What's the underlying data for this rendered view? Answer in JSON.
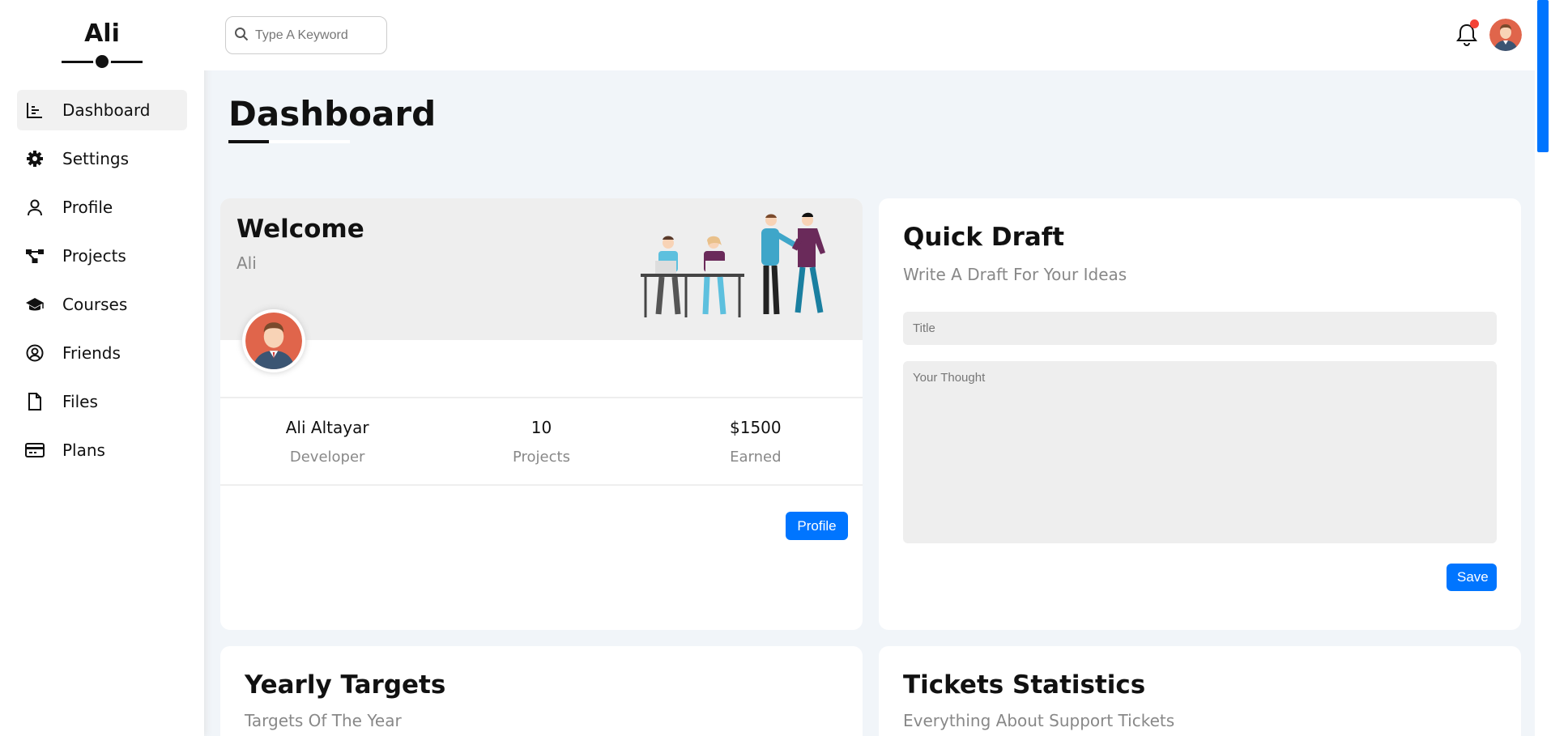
{
  "sidebar": {
    "brand": "Ali",
    "items": [
      {
        "label": "Dashboard",
        "icon": "chart-icon"
      },
      {
        "label": "Settings",
        "icon": "gear-icon"
      },
      {
        "label": "Profile",
        "icon": "user-icon"
      },
      {
        "label": "Projects",
        "icon": "diagram-icon"
      },
      {
        "label": "Courses",
        "icon": "graduation-cap-icon"
      },
      {
        "label": "Friends",
        "icon": "user-circle-icon"
      },
      {
        "label": "Files",
        "icon": "file-icon"
      },
      {
        "label": "Plans",
        "icon": "credit-card-icon"
      }
    ],
    "active": "Dashboard"
  },
  "header": {
    "search_placeholder": "Type A Keyword",
    "notification_icon": "bell-icon"
  },
  "page": {
    "title": "Dashboard"
  },
  "welcome": {
    "title": "Welcome",
    "name": "Ali",
    "stats": [
      {
        "value": "Ali Altayar",
        "label": "Developer"
      },
      {
        "value": "10",
        "label": "Projects"
      },
      {
        "value": "$1500",
        "label": "Earned"
      }
    ],
    "button": "Profile"
  },
  "draft": {
    "title": "Quick Draft",
    "subtitle": "Write A Draft For Your Ideas",
    "title_placeholder": "Title",
    "thought_placeholder": "Your Thought",
    "button": "Save"
  },
  "yearly": {
    "title": "Yearly Targets",
    "subtitle": "Targets Of The Year"
  },
  "tickets": {
    "title": "Tickets Statistics",
    "subtitle": "Everything About Support Tickets"
  },
  "colors": {
    "accent": "#0075ff",
    "background": "#f1f5f9",
    "notification": "#f44336"
  }
}
